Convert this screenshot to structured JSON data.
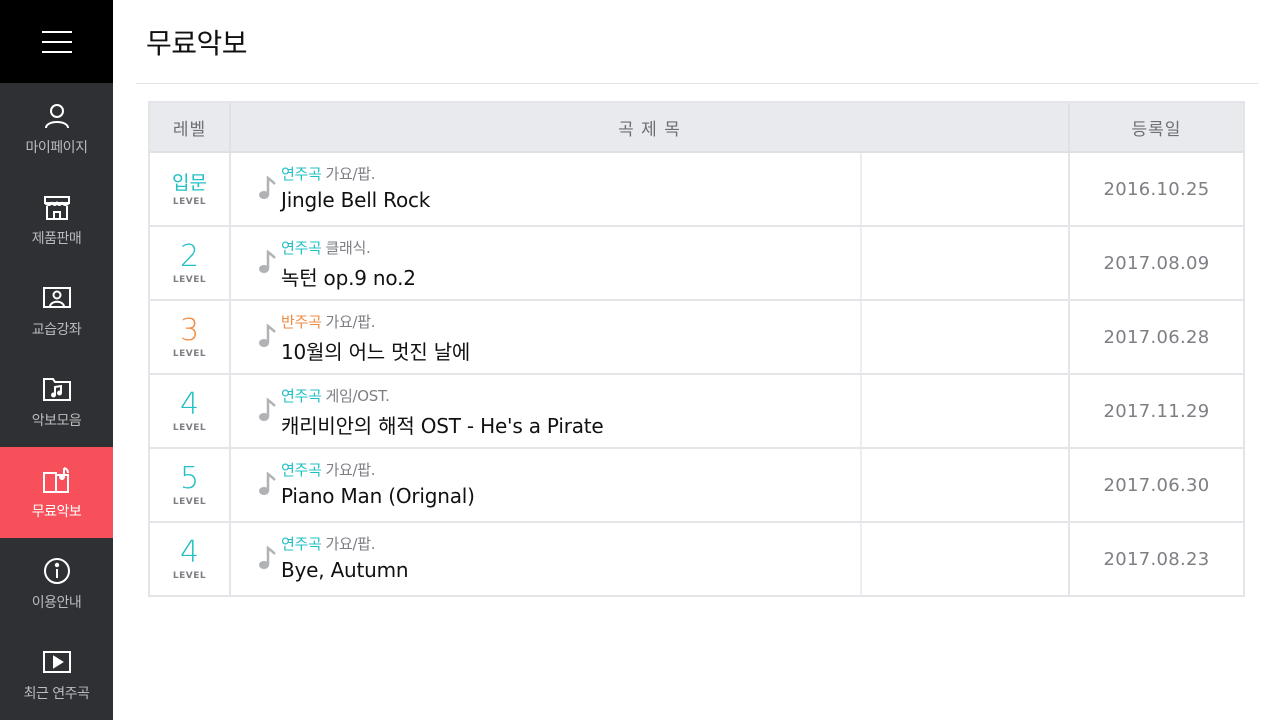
{
  "app": {
    "page_title": "무료악보"
  },
  "sidebar": {
    "menu_icon": "hamburger-icon",
    "items": [
      {
        "label": "마이페이지",
        "icon": "person-icon",
        "active": false
      },
      {
        "label": "제품판매",
        "icon": "store-icon",
        "active": false
      },
      {
        "label": "교습강좌",
        "icon": "lesson-icon",
        "active": false
      },
      {
        "label": "악보모음",
        "icon": "music-folder-icon",
        "active": false
      },
      {
        "label": "무료악보",
        "icon": "free-score-icon",
        "active": true
      },
      {
        "label": "이용안내",
        "icon": "info-icon",
        "active": false
      },
      {
        "label": "최근 연주곡",
        "icon": "play-icon",
        "active": false
      }
    ],
    "active_color": "#f7505a"
  },
  "table": {
    "headers": {
      "level": "레벨",
      "title": "곡 제 목",
      "date": "등록일"
    },
    "rows": [
      {
        "level": "입문",
        "level_caption": "LEVEL",
        "type": "연주곡",
        "genre": "가요/팝.",
        "title": "Jingle Bell Rock",
        "date": "2016.10.25"
      },
      {
        "level": "2",
        "level_caption": "LEVEL",
        "type": "연주곡",
        "genre": "클래식.",
        "title": "녹턴 op.9 no.2",
        "date": "2017.08.09"
      },
      {
        "level": "3",
        "level_caption": "LEVEL",
        "type": "반주곡",
        "genre": "가요/팝.",
        "title": "10월의 어느 멋진 날에",
        "date": "2017.06.28"
      },
      {
        "level": "4",
        "level_caption": "LEVEL",
        "type": "연주곡",
        "genre": "게임/OST.",
        "title": "캐리비안의 해적 OST - He's a Pirate",
        "date": "2017.11.29"
      },
      {
        "level": "5",
        "level_caption": "LEVEL",
        "type": "연주곡",
        "genre": "가요/팝.",
        "title": "Piano Man (Orignal)",
        "date": "2017.06.30"
      },
      {
        "level": "4",
        "level_caption": "LEVEL",
        "type": "연주곡",
        "genre": "가요/팝.",
        "title": "Bye, Autumn",
        "date": "2017.08.23"
      }
    ],
    "colors": {
      "teal": "#22c0c4",
      "orange": "#f08a40"
    }
  }
}
